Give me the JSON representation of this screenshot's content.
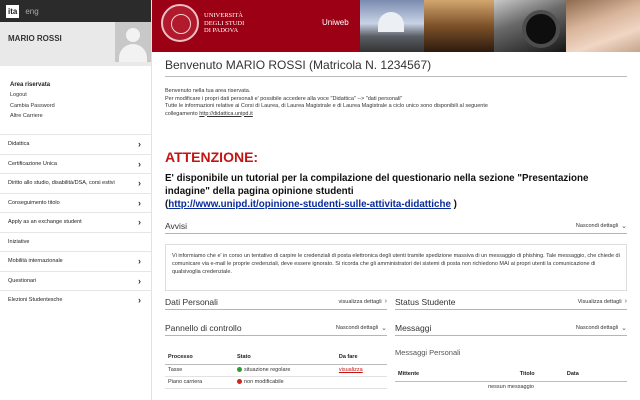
{
  "languages": [
    {
      "label": "ita",
      "active": true
    },
    {
      "label": "eng",
      "active": false
    }
  ],
  "user": {
    "name": "MARIO ROSSI"
  },
  "area": {
    "title": "Area riservata",
    "links": [
      "Logout",
      "Cambia Password",
      "Altre Carriere"
    ]
  },
  "nav": [
    "Didattica",
    "Certificazione Unica",
    "Diritto allo studio, disabilità/DSA, corsi estivi",
    "Conseguimento titolo",
    "Apply as an exchange student",
    "Iniziative",
    "Mobilità internazionale",
    "Questionari",
    "Elezioni Studentesche"
  ],
  "header": {
    "uni_name": "UNIVERSITÀ\nDEGLI STUDI\nDI PADOVA",
    "uniweb": "Uniweb"
  },
  "main": {
    "welcome": "Benvenuto MARIO ROSSI (Matricola N. 1234567)",
    "intro_1": "Benvenuto nella tua area riservata.",
    "intro_2": "Per modificare i propri dati personali e' possibile accedere alla voce \"Didattica\" --> \"dati personali\"",
    "intro_3": "Tutte le informazioni relative ai Corsi di Laurea, di Laurea Magistrale e di Laurea Magistrale a ciclo unico sono disponibili al seguente",
    "intro_4": "collegamento",
    "intro_link": "http://didattica.unipd.it",
    "attenzione": "ATTENZIONE:",
    "tutorial_text": "E' disponibile un tutorial per la compilazione del questionario nella sezione \"Presentazione indagine\" della pagina opinione studenti",
    "tutorial_open": "(",
    "tutorial_url": "http://www.unipd.it/opinione-studenti-sulle-attivita-didattiche",
    "tutorial_close": " )"
  },
  "panels": {
    "avvisi": {
      "title": "Avvisi",
      "action": "Nascondi dettagli"
    },
    "avvisi_body": "Vi informiamo che e' in corso un tentativo di carpire le credenziali di posta elettronica degli utenti tramite spedizione massiva di un messaggio di phishing. Tale messaggio, che chiede di comunicare via e-mail le proprie credenziali, deve essere ignorato. Si ricorda che gli amministratori dei sistemi di posta non richiedono MAI ai propri utenti la comunicazione di qualsivoglia credenziale.",
    "dati_personali": {
      "title": "Dati Personali",
      "action": "visualizza dettagli"
    },
    "status_studente": {
      "title": "Status Studente",
      "action": "Visualizza dettagli"
    },
    "pannello": {
      "title": "Pannello di controllo",
      "action": "Nascondi dettagli"
    },
    "messaggi": {
      "title": "Messaggi",
      "action": "Nascondi dettagli"
    }
  },
  "process_table": {
    "headers": [
      "Processo",
      "Stato",
      "Da fare"
    ],
    "rows": [
      {
        "process": "Tasse",
        "status": "situazione regolare",
        "status_color": "#2e9e2e",
        "todo": "visualizza"
      },
      {
        "process": "Piano carriera",
        "status": "non modificabile",
        "status_color": "#d42121",
        "todo": ""
      }
    ]
  },
  "messages": {
    "title": "Messaggi Personali",
    "headers": [
      "Mittente",
      "Titolo",
      "Data"
    ],
    "empty": "nessun messaggio"
  }
}
